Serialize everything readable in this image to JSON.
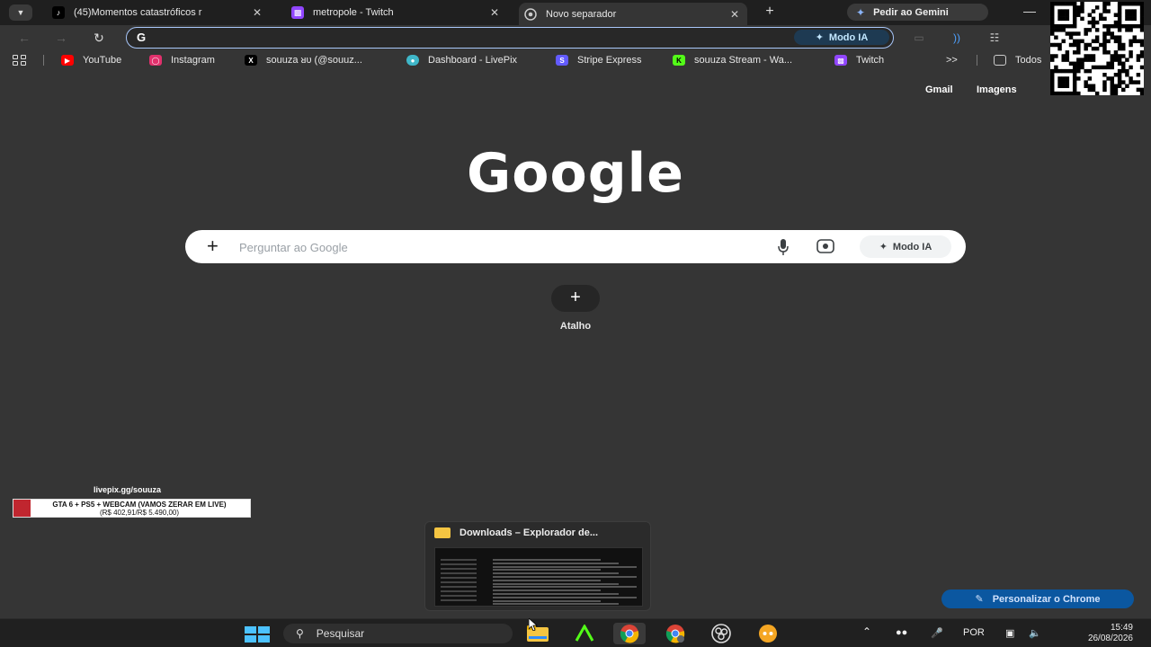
{
  "tabs": [
    {
      "title": "(45)Momentos catastróficos r",
      "icon": "tiktok-icon",
      "active": false
    },
    {
      "title": "metropole - Twitch",
      "icon": "twitch-icon",
      "active": false
    },
    {
      "title": "Novo separador",
      "icon": "chrome-icon",
      "active": true
    }
  ],
  "tab_menu_icon": "chevron-down-icon",
  "gemini_label": "Pedir ao Gemini",
  "omnibox": {
    "value": "",
    "modo_label": "Modo IA"
  },
  "bookmarks": [
    {
      "label": "YouTube",
      "icon": "youtube-icon",
      "color": "#ff0000"
    },
    {
      "label": "Instagram",
      "icon": "instagram-icon",
      "color": "#e1306c"
    },
    {
      "label": "souuza ᴚᴜ (@souuz...",
      "icon": "x-icon",
      "color": "#000000"
    },
    {
      "label": "Dashboard - LivePix",
      "icon": "livepix-icon",
      "color": "#3fb7c9"
    },
    {
      "label": "Stripe Express",
      "icon": "stripe-icon",
      "color": "#635bff"
    },
    {
      "label": "souuza Stream - Wa...",
      "icon": "kick-icon",
      "color": "#53fc18"
    },
    {
      "label": "Twitch",
      "icon": "twitch-icon",
      "color": "#9146ff"
    }
  ],
  "bookmarks_more": ">>",
  "bookmarks_folder": "Todos",
  "top_links": {
    "gmail": "Gmail",
    "images": "Imagens"
  },
  "logo_text": "Google",
  "search": {
    "placeholder": "Perguntar ao Google",
    "modo_label": "Modo IA"
  },
  "shortcut": {
    "label": "Atalho"
  },
  "livepix": {
    "url": "livepix.gg/souuza",
    "goal_title": "GTA 6 + PS5 + WEBCAM (VAMOS ZERAR EM LIVE)",
    "goal_amount": "(R$ 402,91/R$ 5.490,00)",
    "progress": 0.0734
  },
  "explorer_preview": {
    "title": "Downloads – Explorador de..."
  },
  "personalize_label": "Personalizar o Chrome",
  "taskbar": {
    "search_label": "Pesquisar",
    "language": "POR",
    "time": "15:49",
    "date": "26/08/2026"
  },
  "colors": {
    "accent": "#a8c7fa",
    "background": "#353535",
    "personalize": "#0b57a0"
  }
}
